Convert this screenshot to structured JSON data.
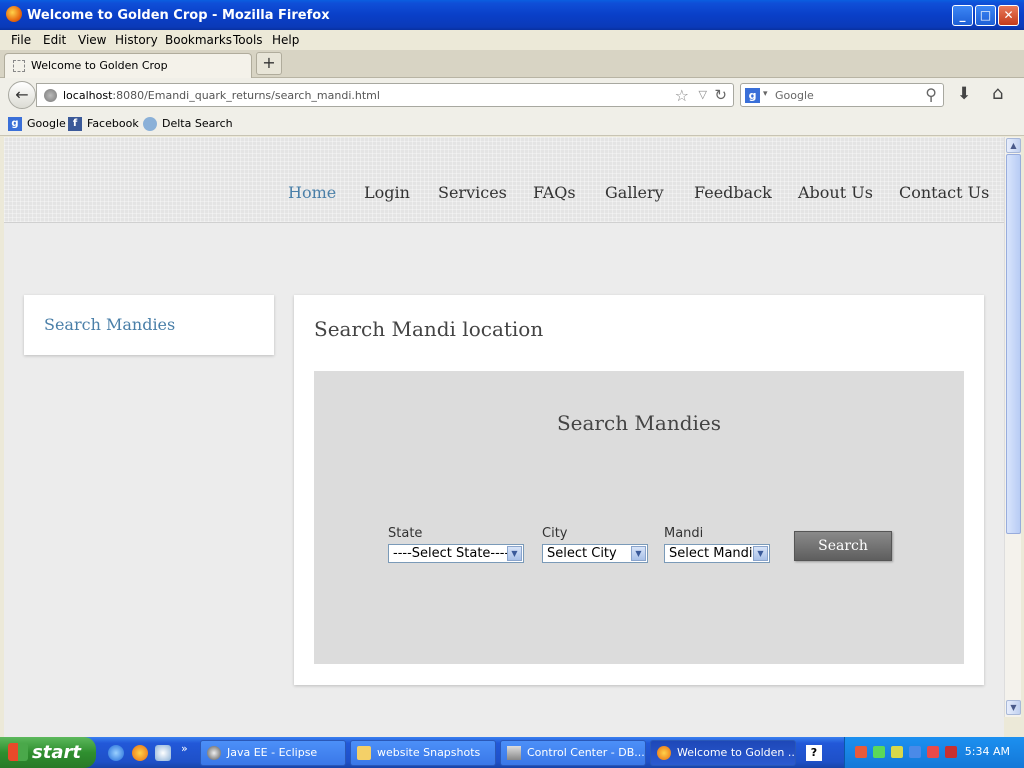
{
  "window": {
    "title": "Welcome to Golden Crop - Mozilla Firefox"
  },
  "menu": [
    "File",
    "Edit",
    "View",
    "History",
    "Bookmarks",
    "Tools",
    "Help"
  ],
  "tab": {
    "title": "Welcome to Golden Crop"
  },
  "address": {
    "host": "localhost",
    "path": ":8080/Emandi_quark_returns/search_mandi.html"
  },
  "search": {
    "placeholder": "Google"
  },
  "bookmarks": [
    "Google",
    "Facebook",
    "Delta Search"
  ],
  "site": {
    "nav": [
      "Home",
      "Login",
      "Services",
      "FAQs",
      "Gallery",
      "Feedback",
      "About Us",
      "Contact Us"
    ],
    "sidebar_link": "Search Mandies",
    "page_heading": "Search Mandi location",
    "panel_title": "Search Mandies",
    "fields": {
      "state_label": "State",
      "state_value": "----Select State----",
      "city_label": "City",
      "city_value": "Select City",
      "mandi_label": "Mandi",
      "mandi_value": "Select Mandi"
    },
    "search_button": "Search"
  },
  "taskbar": {
    "start": "start",
    "items": [
      "Java EE - Eclipse",
      "website Snapshots",
      "Control Center - DB...",
      "Welcome to Golden ..."
    ],
    "clock": "5:34 AM"
  }
}
